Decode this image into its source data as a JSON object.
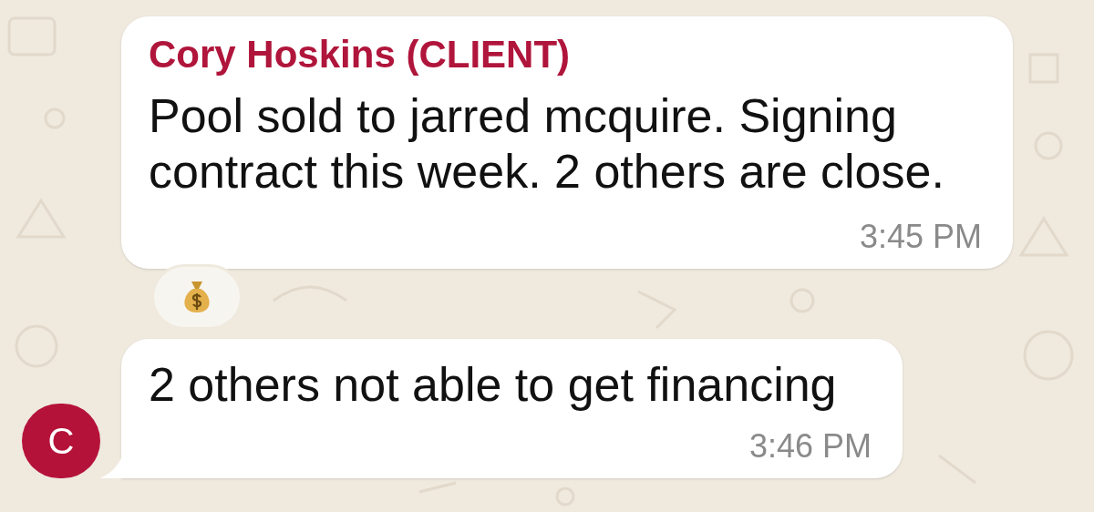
{
  "messages": [
    {
      "sender": "Cory Hoskins (CLIENT)",
      "text": "Pool sold to jarred mcquire. Signing contract this week. 2 others are close.",
      "time": "3:45 PM",
      "reacted": true
    },
    {
      "text": "2 others not able to get financing",
      "time": "3:46 PM",
      "reacted": false,
      "avatar": "C"
    }
  ]
}
